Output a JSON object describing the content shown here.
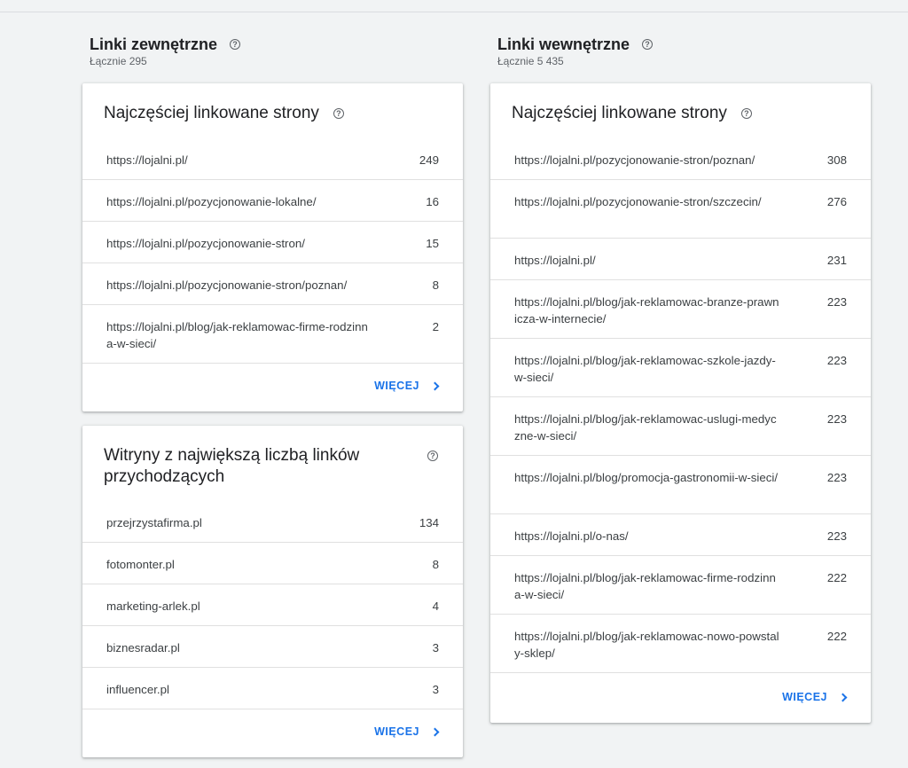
{
  "external": {
    "title": "Linki zewnętrzne",
    "total": "Łącznie 295",
    "top_pages": {
      "title": "Najczęściej linkowane strony",
      "rows": [
        {
          "url": "https://lojalni.pl/",
          "count": "249"
        },
        {
          "url": "https://lojalni.pl/pozycjonowanie-lokalne/",
          "count": "16"
        },
        {
          "url": "https://lojalni.pl/pozycjonowanie-stron/",
          "count": "15"
        },
        {
          "url": "https://lojalni.pl/pozycjonowanie-stron/poznan/",
          "count": "8"
        },
        {
          "url": "https://lojalni.pl/blog/jak-reklamowac-firme-rodzinna-w-sieci/",
          "count": "2"
        }
      ],
      "more_label": "WIĘCEJ"
    },
    "top_sites": {
      "title": "Witryny z największą liczbą linków przychodzących",
      "rows": [
        {
          "url": "przejrzystafirma.pl",
          "count": "134"
        },
        {
          "url": "fotomonter.pl",
          "count": "8"
        },
        {
          "url": "marketing-arlek.pl",
          "count": "4"
        },
        {
          "url": "biznesradar.pl",
          "count": "3"
        },
        {
          "url": "influencer.pl",
          "count": "3"
        }
      ],
      "more_label": "WIĘCEJ"
    }
  },
  "internal": {
    "title": "Linki wewnętrzne",
    "total": "Łącznie 5 435",
    "top_pages": {
      "title": "Najczęściej linkowane strony",
      "rows": [
        {
          "url": "https://lojalni.pl/pozycjonowanie-stron/poznan/",
          "count": "308"
        },
        {
          "url": "https://lojalni.pl/pozycjonowanie-stron/szczecin/",
          "count": "276"
        },
        {
          "url": "https://lojalni.pl/",
          "count": "231"
        },
        {
          "url": "https://lojalni.pl/blog/jak-reklamowac-branze-prawnicza-w-internecie/",
          "count": "223"
        },
        {
          "url": "https://lojalni.pl/blog/jak-reklamowac-szkole-jazdy-w-sieci/",
          "count": "223"
        },
        {
          "url": "https://lojalni.pl/blog/jak-reklamowac-uslugi-medyczne-w-sieci/",
          "count": "223"
        },
        {
          "url": "https://lojalni.pl/blog/promocja-gastronomii-w-sieci/",
          "count": "223"
        },
        {
          "url": "https://lojalni.pl/o-nas/",
          "count": "223"
        },
        {
          "url": "https://lojalni.pl/blog/jak-reklamowac-firme-rodzinna-w-sieci/",
          "count": "222"
        },
        {
          "url": "https://lojalni.pl/blog/jak-reklamowac-nowo-powstaly-sklep/",
          "count": "222"
        }
      ],
      "more_label": "WIĘCEJ"
    }
  },
  "icons": {
    "help": "help-circle-icon",
    "more": "chevron-right-icon"
  },
  "colors": {
    "accent": "#1a73e8",
    "background": "#f1f3f4"
  }
}
